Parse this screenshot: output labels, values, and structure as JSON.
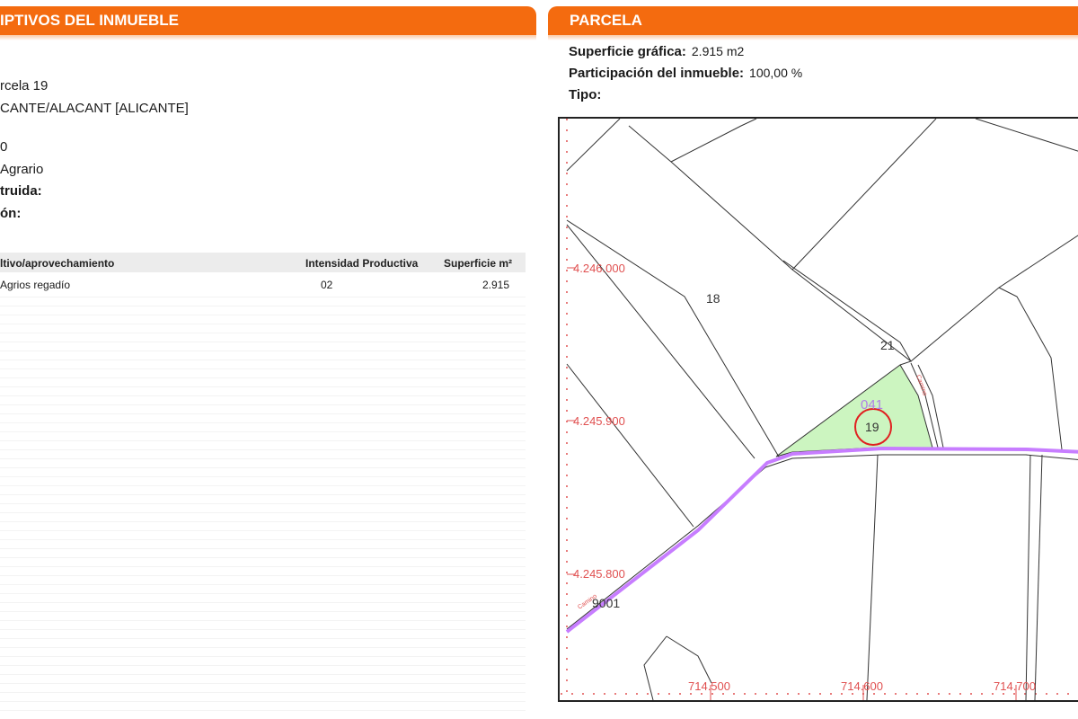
{
  "left_header": {
    "title": "IPTIVOS DEL INMUEBLE"
  },
  "right_header": {
    "title": "PARCELA"
  },
  "left_lines": {
    "line1": "rcela 19",
    "line2": "CANTE/ALACANT [ALICANTE]",
    "line3": "0",
    "line4": "Agrario",
    "line5": "truida:",
    "line6": "ón:"
  },
  "table": {
    "headers": [
      "ltivo/aprovechamiento",
      "Intensidad Productiva",
      "Superficie m²"
    ],
    "rows": [
      [
        "Agrios regadío",
        "02",
        "2.915"
      ]
    ]
  },
  "parcel_info": {
    "surface_label": "Superficie gráfica:",
    "surface_value": "2.915 m2",
    "share_label": "Participación del inmueble:",
    "share_value": "100,00 %",
    "type_label": "Tipo:"
  },
  "map": {
    "y_labels": [
      "4.246.000",
      "4.245.900",
      "4.245.800"
    ],
    "x_labels": [
      "714.500",
      "714.600",
      "714.700"
    ],
    "parcel_labels": [
      "18",
      "21",
      "041",
      "19",
      "9001"
    ],
    "road_labels": [
      "Camino",
      "Camino"
    ],
    "colors": {
      "highlight_fill": "#ccf5c0",
      "road": "#c77dff",
      "circle": "#e02020",
      "grid": "#e05050"
    }
  }
}
